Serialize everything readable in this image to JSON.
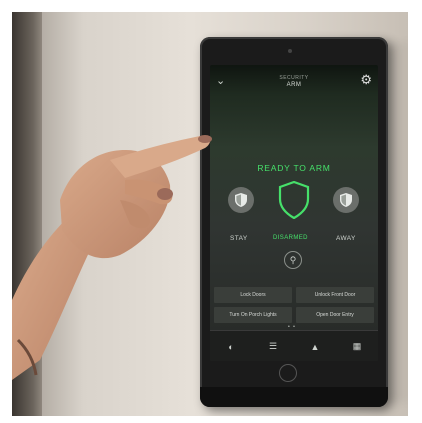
{
  "screen": {
    "header": {
      "subtitle": "SECURITY",
      "title": "ARM"
    },
    "status": "READY TO ARM",
    "modes": [
      {
        "label": "STAY"
      },
      {
        "label": "DISARMED"
      },
      {
        "label": "AWAY"
      }
    ],
    "actions": [
      "Lock Doors",
      "Unlock Front Door",
      "Turn On Porch Lights",
      "Open Door Entry"
    ],
    "page_dots": "• •",
    "nav_icons": [
      "security-icon",
      "list-icon",
      "camera-icon",
      "grid-icon"
    ]
  },
  "colors": {
    "accent": "#46e06a",
    "screen_bg": "#2d3a2e"
  }
}
